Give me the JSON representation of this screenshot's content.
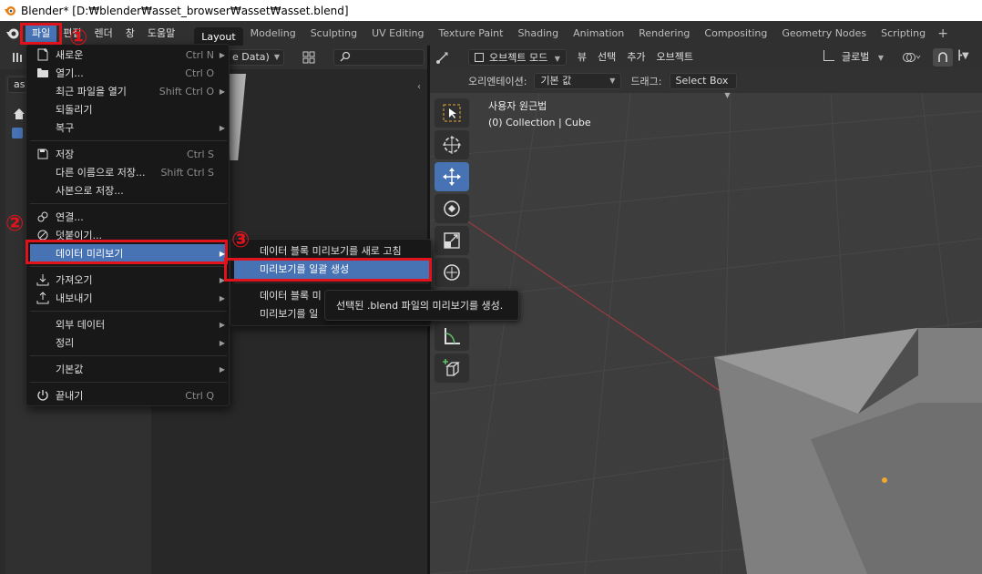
{
  "window": {
    "title": "Blender* [D:₩blender₩asset_browser₩asset₩asset.blend]"
  },
  "menubar": {
    "items": [
      "파일",
      "편집",
      "렌더",
      "창",
      "도움말"
    ],
    "active": "파일"
  },
  "workspaces": [
    "Layout",
    "Modeling",
    "Sculpting",
    "UV Editing",
    "Texture Paint",
    "Shading",
    "Animation",
    "Rendering",
    "Compositing",
    "Geometry Nodes",
    "Scripting"
  ],
  "workspace_active": "Layout",
  "asset_browser": {
    "library_dropdown": "e Data)",
    "search_prefix": "as"
  },
  "file_menu": {
    "items": [
      {
        "label": "새로운",
        "shortcut": "Ctrl N",
        "icon": "new-file-icon",
        "submenu": true
      },
      {
        "label": "열기...",
        "shortcut": "Ctrl O",
        "icon": "folder-icon",
        "submenu": false
      },
      {
        "label": "최근 파일을 열기",
        "shortcut": "Shift Ctrl O",
        "icon": "",
        "submenu": true
      },
      {
        "label": "되돌리기",
        "shortcut": "",
        "icon": "",
        "submenu": false
      },
      {
        "label": "복구",
        "shortcut": "",
        "icon": "",
        "submenu": true
      },
      {
        "label": "저장",
        "shortcut": "Ctrl S",
        "icon": "save-icon",
        "submenu": false
      },
      {
        "label": "다른 이름으로 저장...",
        "shortcut": "Shift Ctrl S",
        "icon": "",
        "submenu": false
      },
      {
        "label": "사본으로 저장...",
        "shortcut": "",
        "icon": "",
        "submenu": false
      },
      {
        "label": "연결...",
        "shortcut": "",
        "icon": "link-icon",
        "submenu": false
      },
      {
        "label": "덧붙이기...",
        "shortcut": "",
        "icon": "append-icon",
        "submenu": false
      },
      {
        "label": "데이터 미리보기",
        "shortcut": "",
        "icon": "",
        "submenu": true
      },
      {
        "label": "가져오기",
        "shortcut": "",
        "icon": "import-icon",
        "submenu": true
      },
      {
        "label": "내보내기",
        "shortcut": "",
        "icon": "export-icon",
        "submenu": true
      },
      {
        "label": "외부 데이터",
        "shortcut": "",
        "icon": "",
        "submenu": true
      },
      {
        "label": "정리",
        "shortcut": "",
        "icon": "",
        "submenu": true
      },
      {
        "label": "기본값",
        "shortcut": "",
        "icon": "",
        "submenu": true
      },
      {
        "label": "끝내기",
        "shortcut": "Ctrl Q",
        "icon": "quit-icon",
        "submenu": false
      }
    ],
    "highlighted": "데이터 미리보기"
  },
  "data_preview_submenu": {
    "items": [
      "데이터 블록 미리보기를 새로 고침",
      "미리보기를 일괄 생성",
      "데이터 블록 미",
      "미리보기를 일"
    ],
    "highlighted": "미리보기를 일괄 생성"
  },
  "tooltip": "선택된 .blend 파일의 미리보기를 생성.",
  "viewport": {
    "mode": "오브젝트 모드",
    "menus": [
      "뷰",
      "선택",
      "추가",
      "오브젝트"
    ],
    "transform_orientation": "글로벌",
    "orientation_label": "오리엔테이션:",
    "orientation_value": "기본 값",
    "drag_label": "드래그:",
    "drag_value": "Select Box",
    "view_name": "사용자 원근법",
    "collection_info": "(0) Collection | Cube"
  },
  "annotations": [
    "①",
    "②",
    "③"
  ],
  "colors": {
    "accent": "#4772b3",
    "annotation": "#e0131d",
    "menu_bg": "#181818"
  }
}
